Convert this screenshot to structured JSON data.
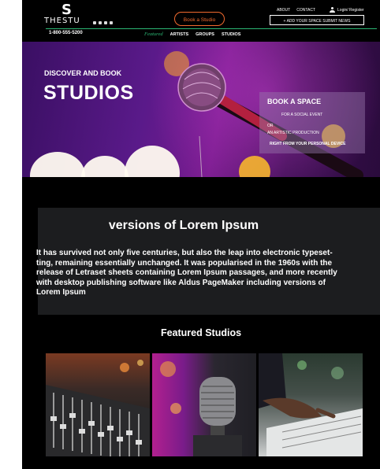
{
  "header": {
    "logo_text": "THESTU",
    "logo_letter": "S",
    "phone": "1-800-555-5200",
    "book_button": "Book a Studio",
    "top_links": {
      "about": "ABOUT",
      "contact": "CONTACT",
      "login": "Login/ Register"
    },
    "add_space_button": "+ ADD YOUR SPACE   SUBMIT NEWS",
    "nav": {
      "featured": "Featured",
      "items": [
        "ARTISTS",
        "GROUPS",
        "STUDIOS"
      ]
    },
    "social_icons": [
      "facebook-icon",
      "instagram-icon",
      "twitter-icon",
      "youtube-icon"
    ]
  },
  "hero": {
    "subtitle": "DISCOVER AND BOOK",
    "title": "STUDIOS",
    "card": {
      "title": "BOOK A SPACE",
      "line1": "FOR A SOCIAL EVENT",
      "line2": "OR",
      "line3": "AN ARTISTIC PRODUCTION",
      "line4": "RIGHT FROM YOUR PERSONAL DEVICE"
    }
  },
  "info": {
    "title": "versions of Lorem Ipsum",
    "body": "It has survived not only five centuries, but also the leap into electronic typeset-\nting, remaining essentially unchanged. It was popularised in the 1960s with the\nrelease of Letraset sheets containing Lorem Ipsum passages, and more recently\nwith desktop publishing software like Aldus PageMaker including versions of\nLorem Ipsum"
  },
  "featured": {
    "title": "Featured Studios",
    "tiles": [
      "mixing-console",
      "studio-microphone",
      "hands-on-mixer"
    ]
  },
  "colors": {
    "accent_green": "#2bb673",
    "accent_orange": "#f26a2e",
    "background": "#000000"
  }
}
